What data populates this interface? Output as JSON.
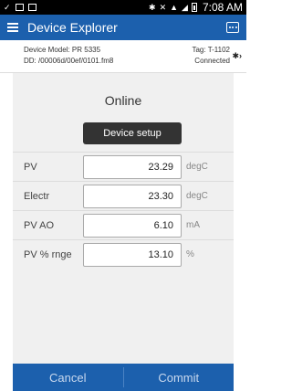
{
  "status_bar": {
    "time": "7:08 AM"
  },
  "app_bar": {
    "title": "Device Explorer"
  },
  "device_info": {
    "model_label": "Device Model:",
    "model_value": "PR 5335",
    "dd_label": "DD:",
    "dd_value": "/00006d/00ef/0101.fm8",
    "tag_label": "Tag:",
    "tag_value": "T-1102",
    "connection_status": "Connected"
  },
  "main": {
    "status": "Online",
    "device_setup_label": "Device setup",
    "rows": [
      {
        "label": "PV",
        "value": "23.29",
        "unit": "degC"
      },
      {
        "label": "Electr",
        "value": "23.30",
        "unit": "degC"
      },
      {
        "label": "PV AO",
        "value": "6.10",
        "unit": "mA"
      },
      {
        "label": "PV % rnge",
        "value": "13.10",
        "unit": "%"
      }
    ]
  },
  "footer": {
    "cancel_label": "Cancel",
    "commit_label": "Commit"
  }
}
